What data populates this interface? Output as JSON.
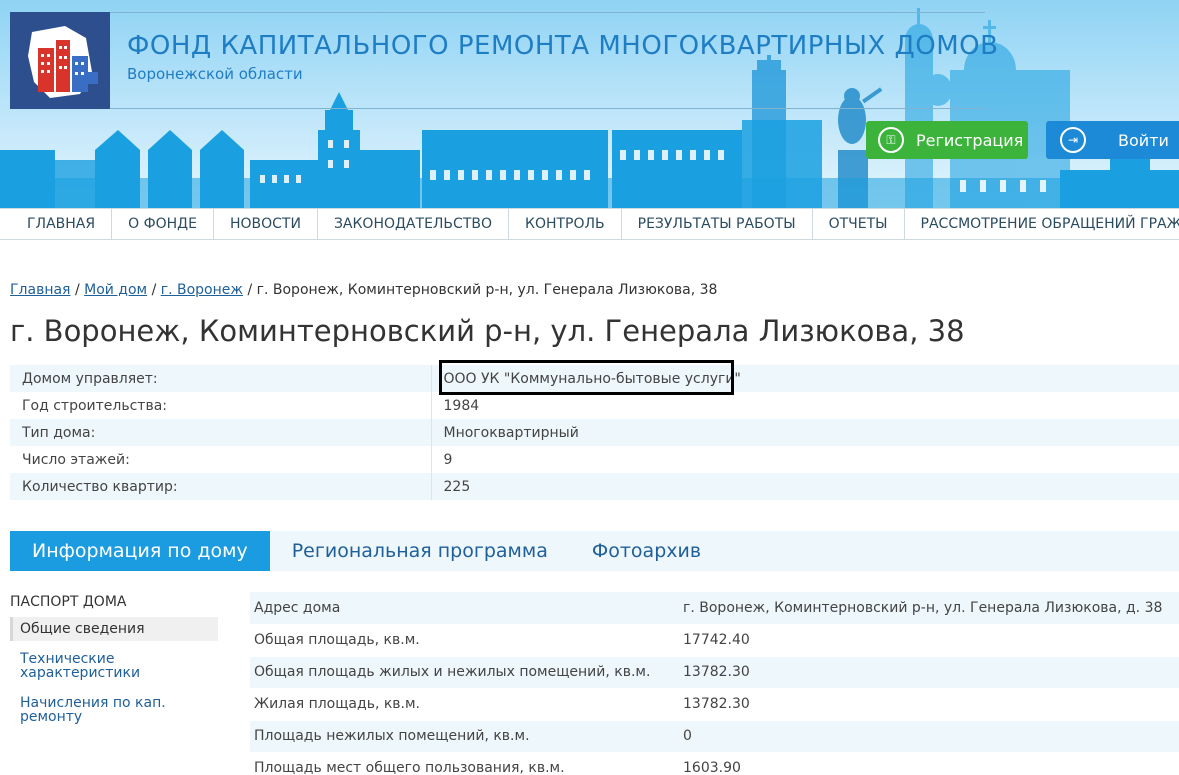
{
  "header": {
    "org_title": "ФОНД КАПИТАЛЬНОГО РЕМОНТА МНОГОКВАРТИРНЫХ ДОМОВ",
    "org_subtitle": "Воронежской области",
    "register_label": "Регистрация",
    "login_label": "Войти",
    "accent_color": "#1b9be0",
    "register_color": "#3cb43c"
  },
  "nav": [
    "ГЛАВНАЯ",
    "О ФОНДЕ",
    "НОВОСТИ",
    "ЗАКОНОДАТЕЛЬСТВО",
    "КОНТРОЛЬ",
    "РЕЗУЛЬТАТЫ РАБОТЫ",
    "ОТЧЕТЫ",
    "РАССМОТРЕНИЕ ОБРАЩЕНИЙ ГРАЖДАН"
  ],
  "breadcrumb": {
    "links": [
      "Главная",
      "Мой дом",
      "г. Воронеж"
    ],
    "separator": "/",
    "current": "г. Воронеж, Коминтерновский р-н, ул. Генерала Лизюкова, 38"
  },
  "page_title": "г. Воронеж, Коминтерновский р-н, ул. Генерала Лизюкова, 38",
  "info": [
    {
      "label": "Домом управляет:",
      "value": "ООО УК \"Коммунально-бытовые услуги\""
    },
    {
      "label": "Год строительства:",
      "value": "1984"
    },
    {
      "label": "Тип дома:",
      "value": "Многоквартирный"
    },
    {
      "label": "Число этажей:",
      "value": "9"
    },
    {
      "label": "Количество квартир:",
      "value": "225"
    }
  ],
  "tabs": [
    "Информация по дому",
    "Региональная программа",
    "Фотоархив"
  ],
  "sidebar": {
    "heading": "ПАСПОРТ ДОМА",
    "active": "Общие сведения",
    "links": [
      {
        "line1": "Технические",
        "line2": "характеристики"
      },
      {
        "line1": "Начисления по кап.",
        "line2": "ремонту"
      }
    ]
  },
  "details": [
    {
      "label": "Адрес дома",
      "value": "г. Воронеж, Коминтерновский р-н, ул. Генерала Лизюкова, д. 38"
    },
    {
      "label": "Общая площадь, кв.м.",
      "value": "17742.40"
    },
    {
      "label": "Общая площадь жилых и нежилых помещений, кв.м.",
      "value": "13782.30"
    },
    {
      "label": "Жилая площадь, кв.м.",
      "value": "13782.30"
    },
    {
      "label": "Площадь нежилых помещений, кв.м.",
      "value": "0"
    },
    {
      "label": "Площадь мест общего пользования, кв.м.",
      "value": "1603.90"
    }
  ]
}
